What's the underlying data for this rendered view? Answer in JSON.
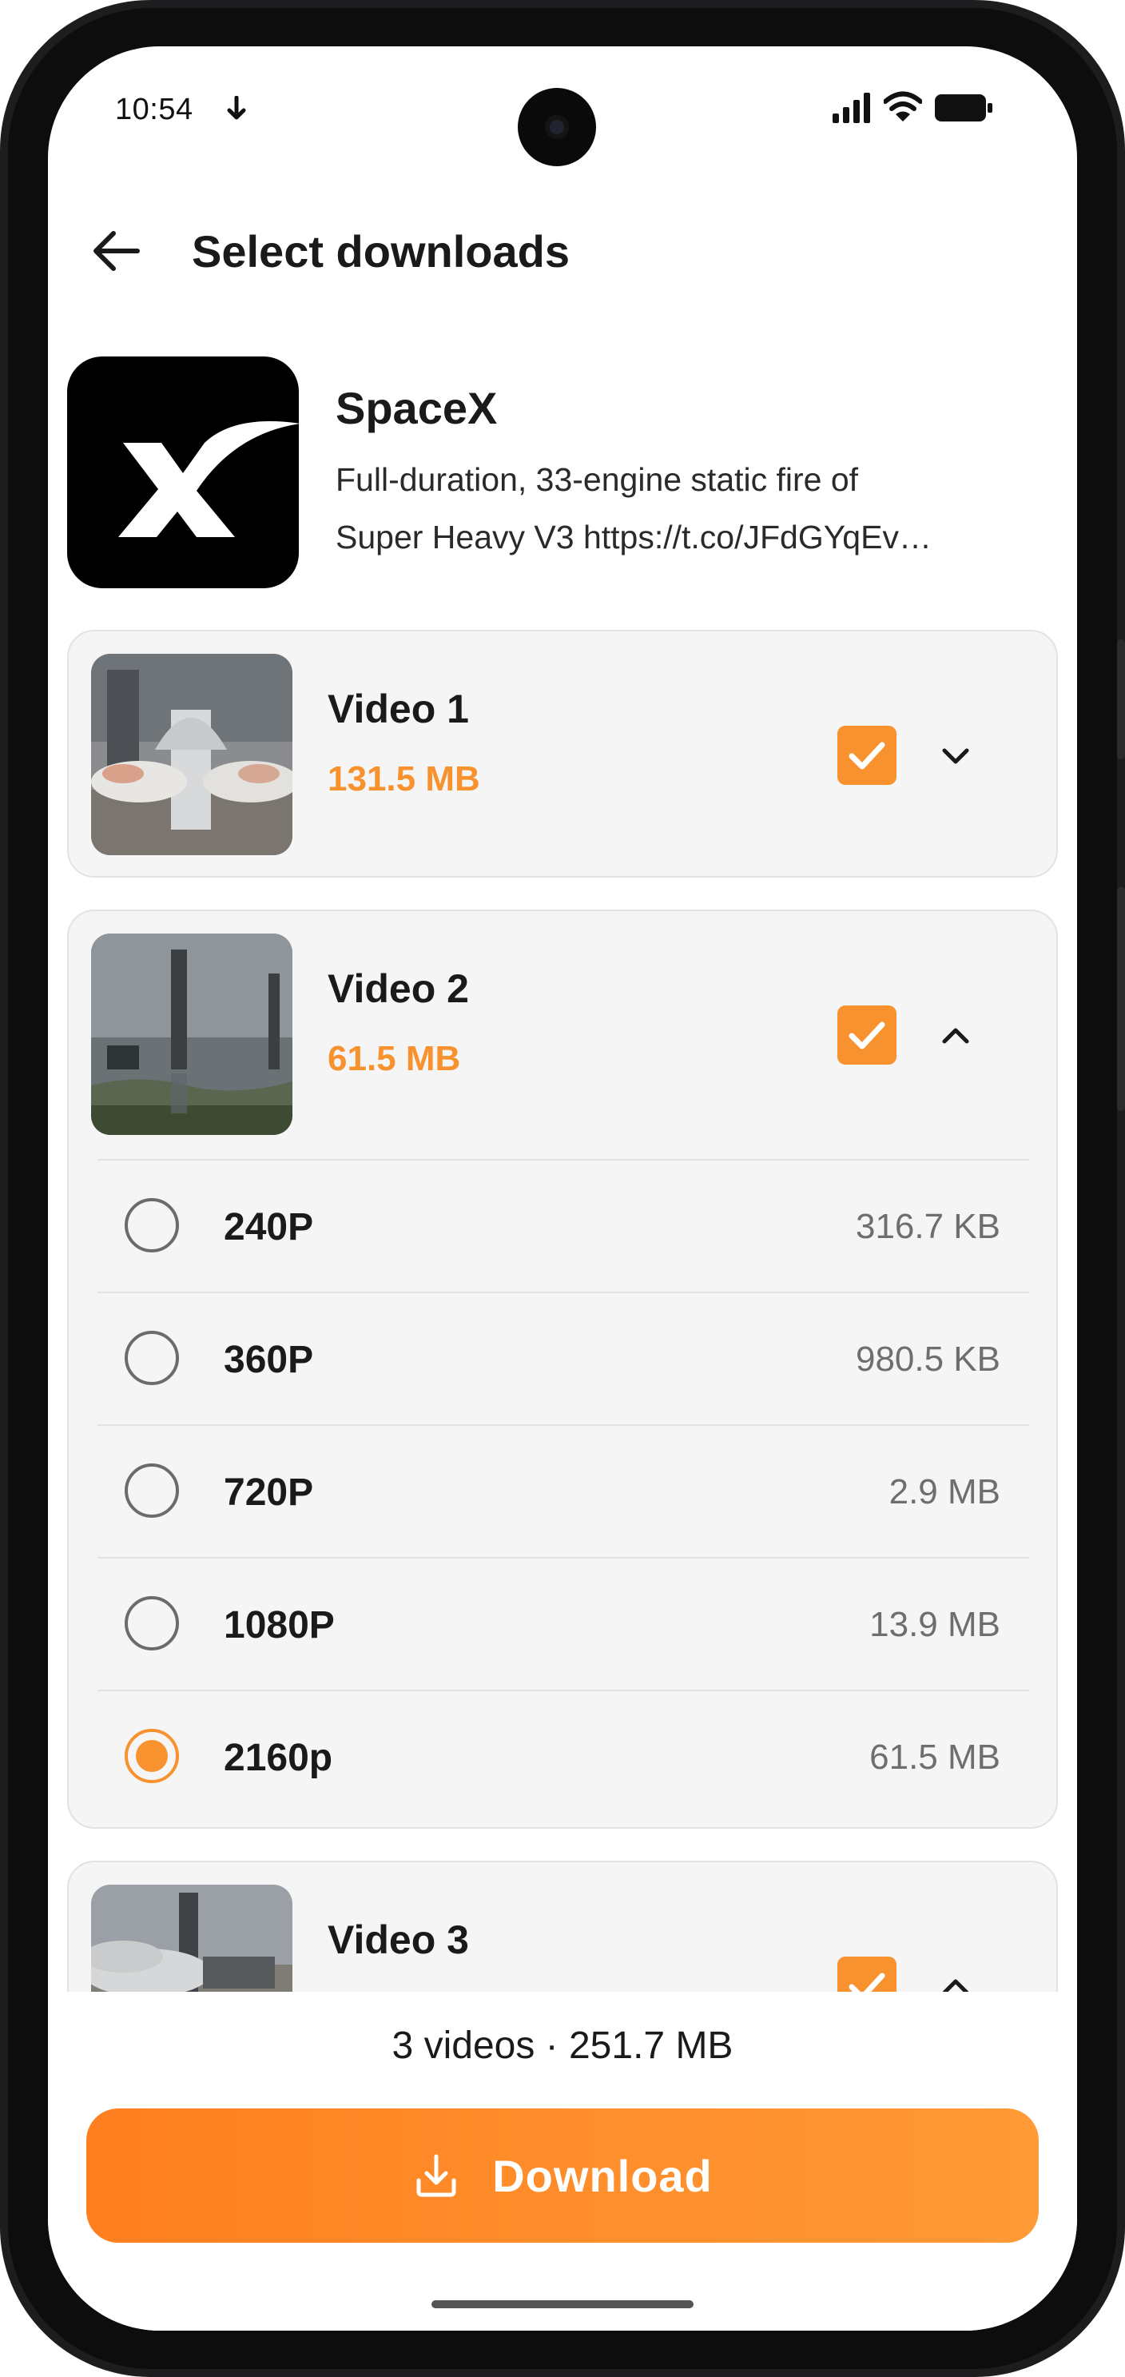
{
  "status_bar": {
    "time": "10:54"
  },
  "header": {
    "title": "Select downloads"
  },
  "channel": {
    "name": "SpaceX",
    "description_line1": "Full-duration, 33-engine static fire of",
    "description_line2": "Super Heavy V3 https://t.co/JFdGYqEv…"
  },
  "videos": [
    {
      "name": "Video 1",
      "size": "131.5 MB",
      "checked": true,
      "expanded": false
    },
    {
      "name": "Video 2",
      "size": "61.5 MB",
      "checked": true,
      "expanded": true,
      "options": [
        {
          "label": "240P",
          "size": "316.7 KB",
          "selected": false
        },
        {
          "label": "360P",
          "size": "980.5 KB",
          "selected": false
        },
        {
          "label": "720P",
          "size": "2.9 MB",
          "selected": false
        },
        {
          "label": "1080P",
          "size": "13.9 MB",
          "selected": false
        },
        {
          "label": "2160p",
          "size": "61.5 MB",
          "selected": true
        }
      ]
    },
    {
      "name": "Video 3",
      "checked": true,
      "expanded": true
    }
  ],
  "footer": {
    "summary": "3 videos · 251.7 MB",
    "download_label": "Download"
  },
  "colors": {
    "accent": "#f7922f",
    "button_start": "#ff7f1f",
    "button_end": "#ff9a36"
  },
  "icons": [
    "back-arrow-icon",
    "download-arrow-icon",
    "signal-icon",
    "wifi-icon",
    "battery-icon",
    "checkbox-checked-icon",
    "chevron-down-icon",
    "chevron-up-icon",
    "download-icon"
  ]
}
